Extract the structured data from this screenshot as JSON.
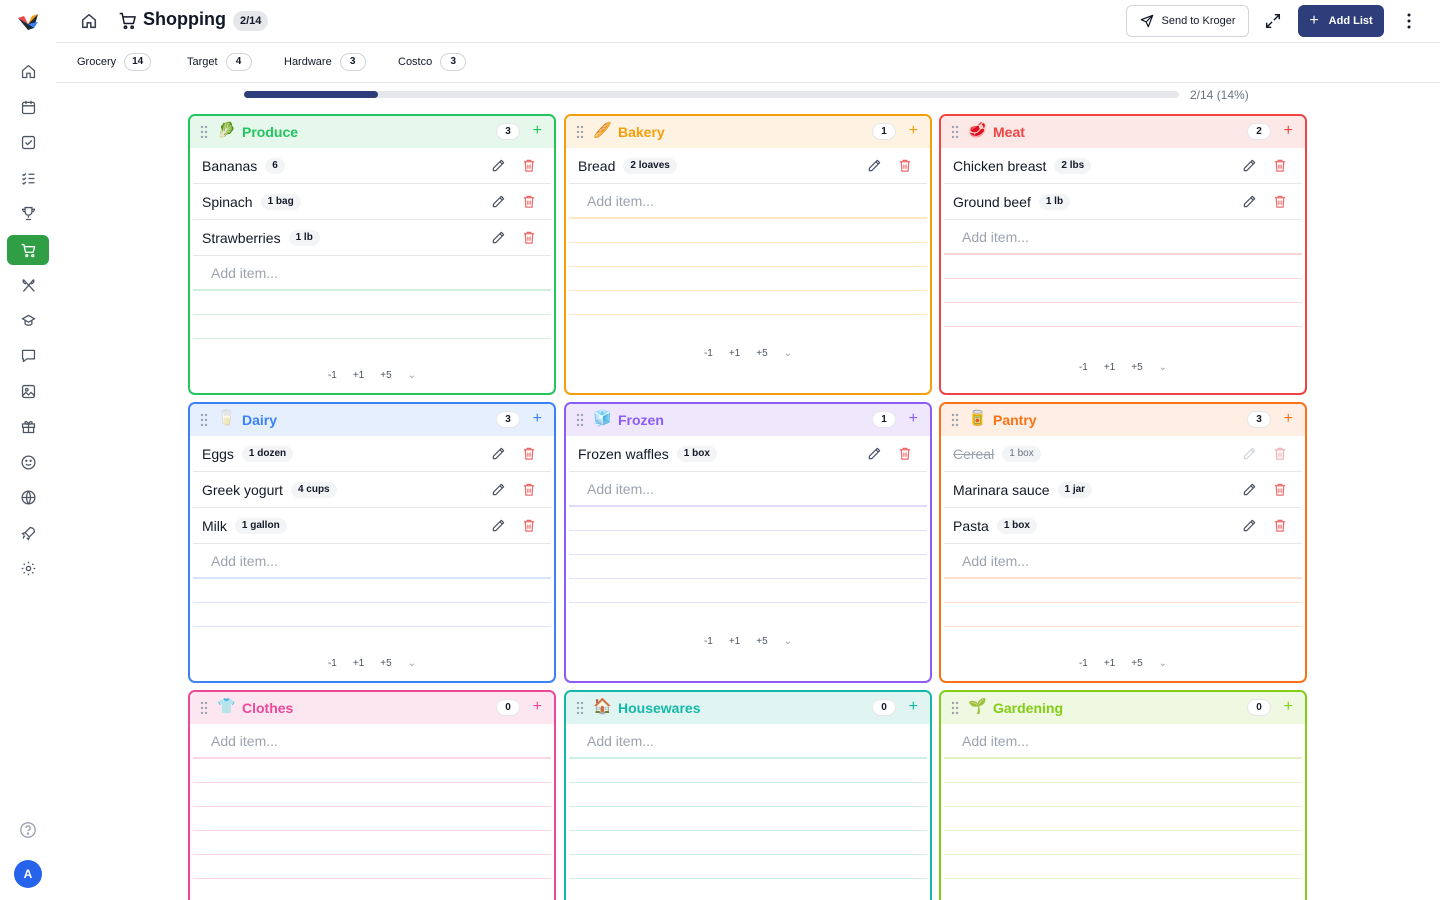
{
  "app": {
    "title": "Shopping",
    "progress_badge": "2/14"
  },
  "header": {
    "send_kroger_label": "Send to Kroger",
    "add_list_label": "Add List"
  },
  "sidebar": {
    "items": [
      "home-icon",
      "calendar-icon",
      "checkbox-icon",
      "checklist-icon",
      "trophy-icon",
      "shopping-cart-icon",
      "utensils-icon",
      "chef-hat-icon",
      "chat-icon",
      "image-icon",
      "gift-icon",
      "smile-icon",
      "globe-icon",
      "rocket-icon",
      "settings-icon"
    ],
    "active": "shopping-cart-icon",
    "avatar_letter": "A"
  },
  "tabs": [
    {
      "label": "Grocery",
      "count": "14"
    },
    {
      "label": "Target",
      "count": "4"
    },
    {
      "label": "Hardware",
      "count": "3"
    },
    {
      "label": "Costco",
      "count": "3"
    }
  ],
  "progress": {
    "done": 2,
    "total": 14,
    "fraction": 0.143,
    "label": "2/14 (14%)"
  },
  "colors": {
    "brand": "#2d3e7a",
    "active_nav": "#2f9e44"
  },
  "add_placeholder": "Add item...",
  "stepper": {
    "minus1": "-1",
    "plus1": "+1",
    "plus5": "+5"
  },
  "categories": [
    {
      "name": "Produce",
      "emoji": "🥬",
      "count": "3",
      "color": "#22c55e",
      "bg": "#e6f7ec",
      "line": "#d1f0dc",
      "items": [
        {
          "name": "Bananas",
          "qty": "6"
        },
        {
          "name": "Spinach",
          "qty": "1 bag"
        },
        {
          "name": "Strawberries",
          "qty": "1 lb"
        }
      ]
    },
    {
      "name": "Bakery",
      "emoji": "🥖",
      "count": "1",
      "color": "#f59e0b",
      "bg": "#fef3e2",
      "line": "#fde7c4",
      "items": [
        {
          "name": "Bread",
          "qty": "2 loaves"
        }
      ]
    },
    {
      "name": "Meat",
      "emoji": "🥩",
      "count": "2",
      "color": "#ef4444",
      "bg": "#fde8e8",
      "line": "#fbd5d5",
      "items": [
        {
          "name": "Chicken breast",
          "qty": "2 lbs"
        },
        {
          "name": "Ground beef",
          "qty": "1 lb"
        }
      ]
    },
    {
      "name": "Dairy",
      "emoji": "🥛",
      "count": "3",
      "color": "#3b82f6",
      "bg": "#e5effd",
      "line": "#d6e4fb",
      "items": [
        {
          "name": "Eggs",
          "qty": "1 dozen"
        },
        {
          "name": "Greek yogurt",
          "qty": "4 cups"
        },
        {
          "name": "Milk",
          "qty": "1 gallon"
        }
      ]
    },
    {
      "name": "Frozen",
      "emoji": "🧊",
      "count": "1",
      "color": "#8b5cf6",
      "bg": "#efe8fd",
      "line": "#e3d9fb",
      "items": [
        {
          "name": "Frozen waffles",
          "qty": "1 box"
        }
      ]
    },
    {
      "name": "Pantry",
      "emoji": "🥫",
      "count": "3",
      "color": "#f97316",
      "bg": "#feeee3",
      "line": "#fde0cc",
      "items": [
        {
          "name": "Cereal",
          "qty": "1 box",
          "done": true
        },
        {
          "name": "Marinara sauce",
          "qty": "1 jar"
        },
        {
          "name": "Pasta",
          "qty": "1 box"
        }
      ]
    },
    {
      "name": "Clothes",
      "emoji": "👕",
      "count": "0",
      "color": "#ec4899",
      "bg": "#fce7f1",
      "line": "#f9d5e6",
      "items": []
    },
    {
      "name": "Housewares",
      "emoji": "🏠",
      "count": "0",
      "color": "#14b8a6",
      "bg": "#e0f5f2",
      "line": "#cdeee9",
      "items": []
    },
    {
      "name": "Gardening",
      "emoji": "🌱",
      "count": "0",
      "color": "#84cc16",
      "bg": "#eff8e0",
      "line": "#e2f2c6",
      "items": []
    }
  ]
}
